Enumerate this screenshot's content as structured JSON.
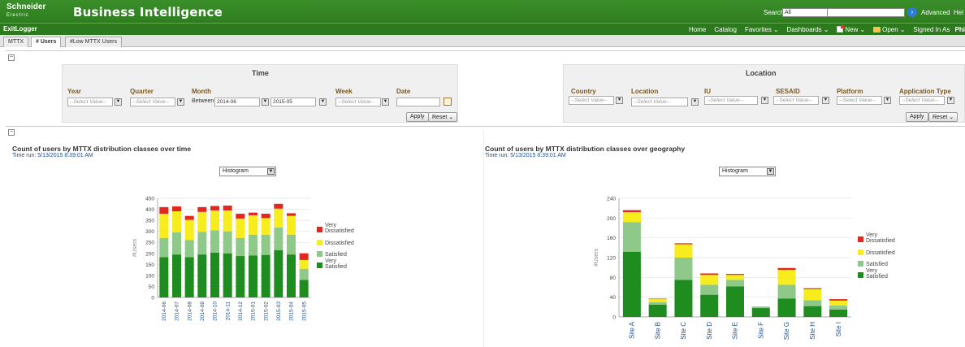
{
  "app": {
    "logo_line1": "Schneider",
    "logo_line2": "Electric",
    "title": "Business Intelligence",
    "search_label": "Search",
    "search_scope": "All",
    "advanced_label": "Advanced",
    "help_label": "Hel"
  },
  "nav": {
    "dashboard_title": "ExitLogger",
    "links": {
      "home": "Home",
      "catalog": "Catalog",
      "favorites": "Favorites",
      "dashboards": "Dashboards",
      "new": "New",
      "open": "Open",
      "signed_in_as": "Signed In As",
      "user": "Phi"
    }
  },
  "tabs": [
    "MTTX",
    "# Users",
    "#Low MTTX Users"
  ],
  "prompts": {
    "time": {
      "heading": "Time",
      "year": {
        "label": "Year",
        "value": "--Select Value--"
      },
      "quarter": {
        "label": "Quarter",
        "value": "--Select Value--"
      },
      "month": {
        "label": "Month",
        "operator": "Between",
        "from": "2014-06",
        "to": "2015-05"
      },
      "week": {
        "label": "Week",
        "value": "--Select Value--"
      },
      "date": {
        "label": "Date",
        "value": ""
      },
      "apply": "Apply",
      "reset": "Reset"
    },
    "location": {
      "heading": "Location",
      "country": {
        "label": "Country",
        "value": "--Select Value--"
      },
      "location": {
        "label": "Location",
        "value": "--Select Value--"
      },
      "iu": {
        "label": "IU",
        "value": "--Select Value--"
      },
      "sesaid": {
        "label": "SESAID",
        "value": "--Select Value--"
      },
      "platform": {
        "label": "Platform",
        "value": "--Select Value--"
      },
      "application_type": {
        "label": "Application Type",
        "value": "--Select Value--"
      },
      "apply": "Apply",
      "reset": "Reset"
    }
  },
  "colors": {
    "very_satisfied": "#1e8c1e",
    "satisfied": "#8fc98a",
    "dissatisfied": "#f6ec1e",
    "very_dissatisfied": "#e3261f",
    "topbar": "#3a8f2a"
  },
  "charts": {
    "left": {
      "title": "Count of users by MTTX distribution classes over time",
      "time_run": "Time run: 5/13/2015 8:39:01 AM",
      "view": "Histogram"
    },
    "right": {
      "title": "Count of users by MTTX distribution classes over geography",
      "time_run": "Time run: 5/13/2015 8:39:01 AM",
      "view": "Histogram"
    }
  },
  "chart_data": [
    {
      "type": "bar",
      "stacked": true,
      "title": "Count of users by MTTX distribution classes over time",
      "ylabel": "#Users",
      "ylim": [
        0,
        450
      ],
      "yticks": [
        0,
        50,
        100,
        150,
        200,
        250,
        300,
        350,
        400,
        450
      ],
      "grid": true,
      "legend": "right",
      "categories": [
        "2014-06",
        "2014-07",
        "2014-08",
        "2014-09",
        "2014-10",
        "2014-11",
        "2014-12",
        "2015-01",
        "2015-02",
        "2015-03",
        "2015-04",
        "2015-05"
      ],
      "series": [
        {
          "name": "Very Satisfied",
          "values": [
            183,
            195,
            183,
            195,
            203,
            200,
            188,
            190,
            193,
            215,
            195,
            80
          ]
        },
        {
          "name": "Satisfied",
          "values": [
            87,
            100,
            77,
            103,
            102,
            100,
            82,
            95,
            92,
            102,
            90,
            50
          ]
        },
        {
          "name": "Dissatisfied",
          "values": [
            110,
            96,
            92,
            90,
            90,
            95,
            88,
            88,
            75,
            86,
            85,
            40
          ]
        },
        {
          "name": "Very Dissatisfied",
          "values": [
            30,
            22,
            18,
            22,
            20,
            22,
            22,
            12,
            20,
            22,
            12,
            30
          ]
        }
      ]
    },
    {
      "type": "bar",
      "stacked": true,
      "title": "Count of users by MTTX distribution classes over geography",
      "ylabel": "#Users",
      "ylim": [
        0,
        240
      ],
      "yticks": [
        0,
        40,
        80,
        120,
        160,
        200,
        240
      ],
      "grid": true,
      "legend": "right",
      "categories": [
        "Site A",
        "Site B",
        "Site C",
        "Site D",
        "Site E",
        "Site F",
        "Site G",
        "Site H",
        "Site I"
      ],
      "series": [
        {
          "name": "Very Satisfied",
          "values": [
            132,
            25,
            75,
            45,
            62,
            18,
            37,
            22,
            15
          ]
        },
        {
          "name": "Satisfied",
          "values": [
            60,
            5,
            45,
            20,
            13,
            3,
            28,
            12,
            8
          ]
        },
        {
          "name": "Dissatisfied",
          "values": [
            20,
            6,
            27,
            20,
            10,
            0,
            30,
            22,
            10
          ]
        },
        {
          "name": "Very Dissatisfied",
          "values": [
            4,
            1,
            2,
            3,
            2,
            0,
            4,
            2,
            3
          ]
        }
      ]
    }
  ]
}
